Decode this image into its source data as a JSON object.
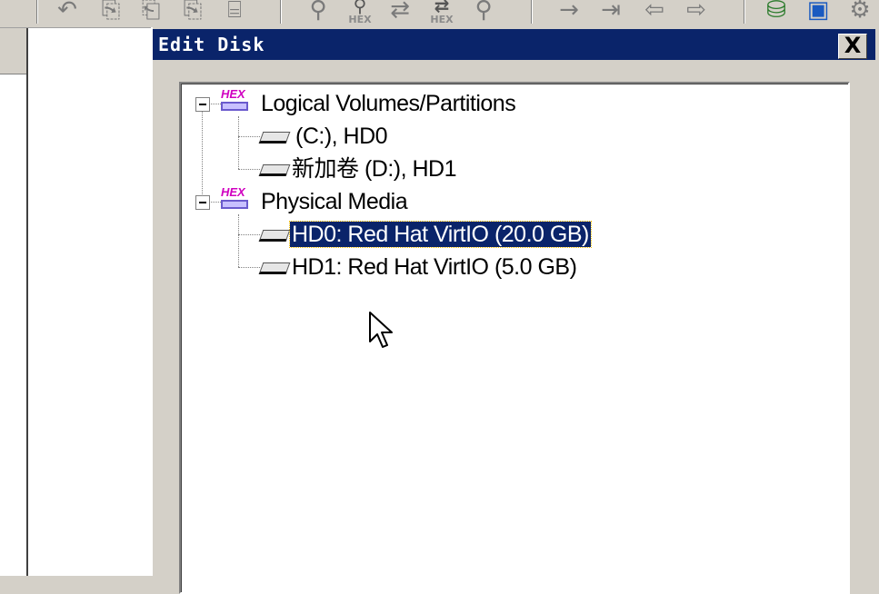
{
  "dialog": {
    "title": "Edit Disk",
    "close_label": "X"
  },
  "tree": {
    "groups": [
      {
        "label": "Logical Volumes/Partitions",
        "items": [
          {
            "label": " (C:), HD0"
          },
          {
            "label": "新加卷 (D:), HD1"
          }
        ]
      },
      {
        "label": "Physical Media",
        "items": [
          {
            "label": "HD0: Red Hat VirtIO (20.0 GB)",
            "selected": true
          },
          {
            "label": "HD1: Red Hat VirtIO (5.0 GB)"
          }
        ]
      }
    ]
  },
  "toolbar": {
    "hex_label": "HEX"
  },
  "colors": {
    "selection": "#0a246a",
    "titlebar": "#0a246a",
    "face": "#d4d0c8"
  }
}
